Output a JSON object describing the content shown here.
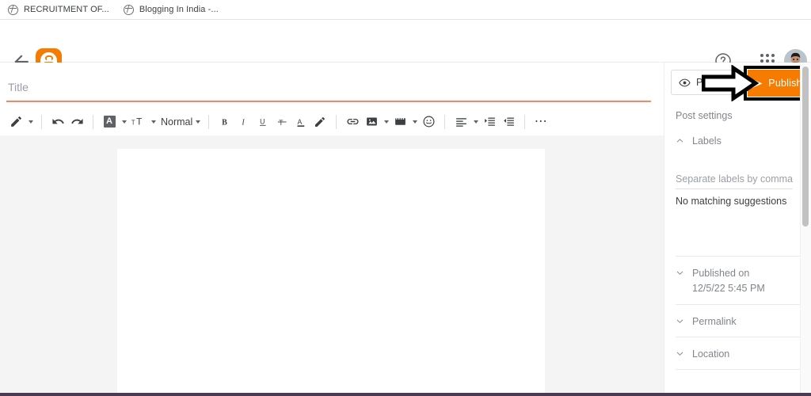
{
  "browser": {
    "tabs": [
      {
        "title": "RECRUITMENT OF...",
        "icon": "globe-icon"
      },
      {
        "title": "Blogging In India -...",
        "icon": "globe-icon"
      }
    ]
  },
  "header": {
    "back_label": "Back",
    "brand": "Blogger",
    "help_label": "Help",
    "apps_label": "Google apps",
    "avatar_label": "Account"
  },
  "editor": {
    "title_value": "",
    "title_placeholder": "Title",
    "toolbar": {
      "pen": "pen-icon",
      "undo": "undo-icon",
      "redo": "redo-icon",
      "text_color_box": "A",
      "font_size": "font-size-icon",
      "paragraph_style": "Normal",
      "bold": "B",
      "italic": "I",
      "underline": "U",
      "strikethrough": "strikethrough-icon",
      "text_color": "A",
      "highlight": "highlight-pen-icon",
      "link": "link-icon",
      "image": "image-icon",
      "video": "video-icon",
      "emoji": "emoji-icon",
      "align": "align-left-icon",
      "indent_increase": "indent-increase-icon",
      "indent_decrease": "indent-decrease-icon",
      "more": "⋯"
    },
    "body_value": ""
  },
  "sidebar": {
    "preview_label": "Preview",
    "publish_label": "Publish",
    "panel_title": "Post settings",
    "labels": {
      "label": "Labels",
      "input_value": "",
      "placeholder": "Separate labels by commas",
      "suggestion": "No matching suggestions"
    },
    "sections": [
      {
        "label": "Published on",
        "value": "12/5/22 5:45 PM",
        "chevron": "chevron-down-icon"
      },
      {
        "label": "Permalink",
        "value": "",
        "chevron": "chevron-down-icon"
      },
      {
        "label": "Location",
        "value": "",
        "chevron": "chevron-down-icon"
      }
    ]
  },
  "colors": {
    "accent_orange": "#f57c00",
    "title_underline": "#f3876a",
    "canvas_gray": "#f4f4f4",
    "text_gray": "#80868b",
    "highlight_border": "#000000"
  }
}
